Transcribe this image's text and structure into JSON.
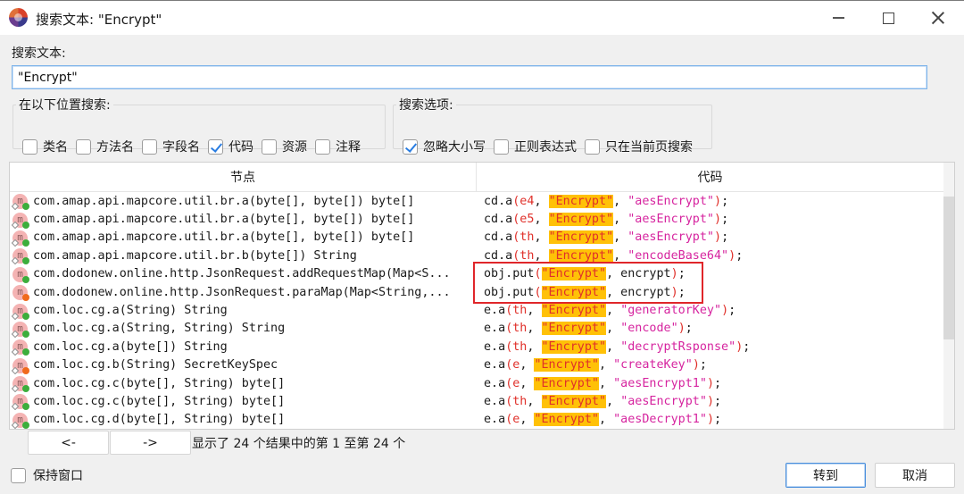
{
  "window": {
    "title": "搜索文本: \"Encrypt\"",
    "icon": "jadx-app-icon",
    "controls": [
      "minimize",
      "maximize",
      "close"
    ]
  },
  "search": {
    "label": "搜索文本:",
    "value": "\"Encrypt\""
  },
  "search_location": {
    "legend": "在以下位置搜索:",
    "options": [
      {
        "label": "类名",
        "checked": false
      },
      {
        "label": "方法名",
        "checked": false
      },
      {
        "label": "字段名",
        "checked": false
      },
      {
        "label": "代码",
        "checked": true
      },
      {
        "label": "资源",
        "checked": false
      },
      {
        "label": "注释",
        "checked": false
      }
    ]
  },
  "search_options": {
    "legend": "搜索选项:",
    "options": [
      {
        "label": "忽略大小写",
        "checked": true
      },
      {
        "label": "正则表达式",
        "checked": false
      },
      {
        "label": "只在当前页搜索",
        "checked": false
      }
    ]
  },
  "results": {
    "columns": [
      "节点",
      "代码"
    ],
    "highlight_color": "#ffc107",
    "rows": [
      {
        "node": "com.amap.api.mapcore.util.br.a(byte[], byte[]) byte[]",
        "access": "public",
        "static": true,
        "code": [
          [
            "",
            "cd.a"
          ],
          [
            "red",
            "(e4"
          ],
          [
            "",
            ", "
          ],
          [
            "hl",
            "\"Encrypt\""
          ],
          [
            "",
            ", "
          ],
          [
            "str",
            "\"aesEncrypt\""
          ],
          [
            "red",
            ")"
          ],
          [
            "",
            ";"
          ]
        ]
      },
      {
        "node": "com.amap.api.mapcore.util.br.a(byte[], byte[]) byte[]",
        "access": "public",
        "static": true,
        "code": [
          [
            "",
            "cd.a"
          ],
          [
            "red",
            "(e5"
          ],
          [
            "",
            ", "
          ],
          [
            "hl",
            "\"Encrypt\""
          ],
          [
            "",
            ", "
          ],
          [
            "str",
            "\"aesEncrypt\""
          ],
          [
            "red",
            ")"
          ],
          [
            "",
            ";"
          ]
        ]
      },
      {
        "node": "com.amap.api.mapcore.util.br.a(byte[], byte[]) byte[]",
        "access": "public",
        "static": true,
        "code": [
          [
            "",
            "cd.a"
          ],
          [
            "red",
            "(th"
          ],
          [
            "",
            ", "
          ],
          [
            "hl",
            "\"Encrypt\""
          ],
          [
            "",
            ", "
          ],
          [
            "str",
            "\"aesEncrypt\""
          ],
          [
            "red",
            ")"
          ],
          [
            "",
            ";"
          ]
        ]
      },
      {
        "node": "com.amap.api.mapcore.util.br.b(byte[]) String",
        "access": "public",
        "static": true,
        "code": [
          [
            "",
            "cd.a"
          ],
          [
            "red",
            "(th"
          ],
          [
            "",
            ", "
          ],
          [
            "hl",
            "\"Encrypt\""
          ],
          [
            "",
            ", "
          ],
          [
            "str",
            "\"encodeBase64\""
          ],
          [
            "red",
            ")"
          ],
          [
            "",
            ";"
          ]
        ]
      },
      {
        "node": "com.dodonew.online.http.JsonRequest.addRequestMap(Map<S...",
        "access": "public",
        "static": false,
        "code": [
          [
            "",
            "obj.put"
          ],
          [
            "red",
            "("
          ],
          [
            "hl",
            "\"Encrypt\""
          ],
          [
            "",
            ", encrypt"
          ],
          [
            "red",
            ")"
          ],
          [
            "",
            ";"
          ]
        ]
      },
      {
        "node": "com.dodonew.online.http.JsonRequest.paraMap(Map<String,...",
        "access": "private",
        "static": false,
        "code": [
          [
            "",
            "obj.put"
          ],
          [
            "red",
            "("
          ],
          [
            "hl",
            "\"Encrypt\""
          ],
          [
            "",
            ", encrypt"
          ],
          [
            "red",
            ")"
          ],
          [
            "",
            ";"
          ]
        ]
      },
      {
        "node": "com.loc.cg.a(String) String",
        "access": "public",
        "static": true,
        "code": [
          [
            "",
            "e.a"
          ],
          [
            "red",
            "(th"
          ],
          [
            "",
            ", "
          ],
          [
            "hl",
            "\"Encrypt\""
          ],
          [
            "",
            ", "
          ],
          [
            "str",
            "\"generatorKey\""
          ],
          [
            "red",
            ")"
          ],
          [
            "",
            ";"
          ]
        ]
      },
      {
        "node": "com.loc.cg.a(String, String) String",
        "access": "public",
        "static": true,
        "code": [
          [
            "",
            "e.a"
          ],
          [
            "red",
            "(th"
          ],
          [
            "",
            ", "
          ],
          [
            "hl",
            "\"Encrypt\""
          ],
          [
            "",
            ", "
          ],
          [
            "str",
            "\"encode\""
          ],
          [
            "red",
            ")"
          ],
          [
            "",
            ";"
          ]
        ]
      },
      {
        "node": "com.loc.cg.a(byte[]) String",
        "access": "public",
        "static": true,
        "code": [
          [
            "",
            "e.a"
          ],
          [
            "red",
            "(th"
          ],
          [
            "",
            ", "
          ],
          [
            "hl",
            "\"Encrypt\""
          ],
          [
            "",
            ", "
          ],
          [
            "str",
            "\"decryptRsponse\""
          ],
          [
            "red",
            ")"
          ],
          [
            "",
            ";"
          ]
        ]
      },
      {
        "node": "com.loc.cg.b(String) SecretKeySpec",
        "access": "private",
        "static": true,
        "code": [
          [
            "",
            "e.a"
          ],
          [
            "red",
            "(e"
          ],
          [
            "",
            ", "
          ],
          [
            "hl",
            "\"Encrypt\""
          ],
          [
            "",
            ", "
          ],
          [
            "str",
            "\"createKey\""
          ],
          [
            "red",
            ")"
          ],
          [
            "",
            ";"
          ]
        ]
      },
      {
        "node": "com.loc.cg.c(byte[], String) byte[]",
        "access": "public",
        "static": true,
        "code": [
          [
            "",
            "e.a"
          ],
          [
            "red",
            "(e"
          ],
          [
            "",
            ", "
          ],
          [
            "hl",
            "\"Encrypt\""
          ],
          [
            "",
            ", "
          ],
          [
            "str",
            "\"aesEncrypt1\""
          ],
          [
            "red",
            ")"
          ],
          [
            "",
            ";"
          ]
        ]
      },
      {
        "node": "com.loc.cg.c(byte[], String) byte[]",
        "access": "public",
        "static": true,
        "code": [
          [
            "",
            "e.a"
          ],
          [
            "red",
            "(th"
          ],
          [
            "",
            ", "
          ],
          [
            "hl",
            "\"Encrypt\""
          ],
          [
            "",
            ", "
          ],
          [
            "str",
            "\"aesEncrypt\""
          ],
          [
            "red",
            ")"
          ],
          [
            "",
            ";"
          ]
        ]
      },
      {
        "node": "com.loc.cg.d(byte[], String) byte[]",
        "access": "public",
        "static": true,
        "code": [
          [
            "",
            "e.a"
          ],
          [
            "red",
            "(e"
          ],
          [
            "",
            ", "
          ],
          [
            "hl",
            "\"Encrypt\""
          ],
          [
            "",
            ", "
          ],
          [
            "str",
            "\"aesDecrypt1\""
          ],
          [
            "red",
            ")"
          ],
          [
            "",
            ";"
          ]
        ]
      }
    ],
    "highlighted_rows": [
      4,
      5
    ]
  },
  "pagination": {
    "prev_label": "<-",
    "next_label": "->",
    "status": "显示了 24 个结果中的第 1 至第 24 个"
  },
  "footer": {
    "keep_open_label": "保持窗口",
    "keep_open_checked": false,
    "goto_label": "转到",
    "cancel_label": "取消"
  }
}
